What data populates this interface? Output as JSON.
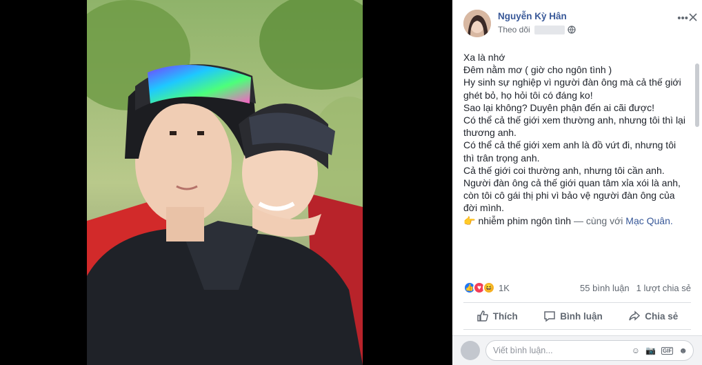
{
  "post": {
    "author_name": "Nguyễn Kỳ Hân",
    "follow_label": "Theo dõi",
    "text_lines": [
      "Xa là nhớ",
      "Đêm nằm mơ ( giờ cho ngôn tình )",
      "Hy sinh sự nghiệp vì người đàn ông mà cả thế giới ghét bỏ, họ hỏi tôi có đáng ko!",
      "Sao lại không? Duyên phận đến ai cãi được!",
      "Có thể cả thế giới xem thường anh, nhưng tôi thì lại thương anh.",
      "Có thể cả thế giới xem anh là đồ vứt đi, nhưng tôi thì trân trọng anh.",
      "Cả thế giới coi thường anh, nhưng tôi cần anh.",
      "Người đàn ông cả thế giới quan tâm xỉa xói là anh, còn tôi cô gái thị phi vì bảo vệ người đàn ông của đời mình."
    ],
    "feeling_text": "nhiễm phim ngôn tình",
    "with_text": "— cùng với",
    "tagged_name": "Mạc Quân."
  },
  "reactions": {
    "count": "1K",
    "comments": "55 bình luận",
    "shares": "1 lượt chia sẻ"
  },
  "actions": {
    "like": "Thích",
    "comment": "Bình luận",
    "share": "Chia sẻ"
  },
  "comment_box": {
    "placeholder": "Viết bình luận..."
  },
  "icons": [
    "more-icon",
    "close-icon",
    "globe-icon",
    "like-icon",
    "comment-icon",
    "share-icon",
    "emoji-icon",
    "camera-icon",
    "gif-icon",
    "sticker-icon"
  ],
  "colors": {
    "link": "#385898",
    "like": "#2078f4",
    "love": "#f33e58",
    "haha": "#f7b125"
  }
}
